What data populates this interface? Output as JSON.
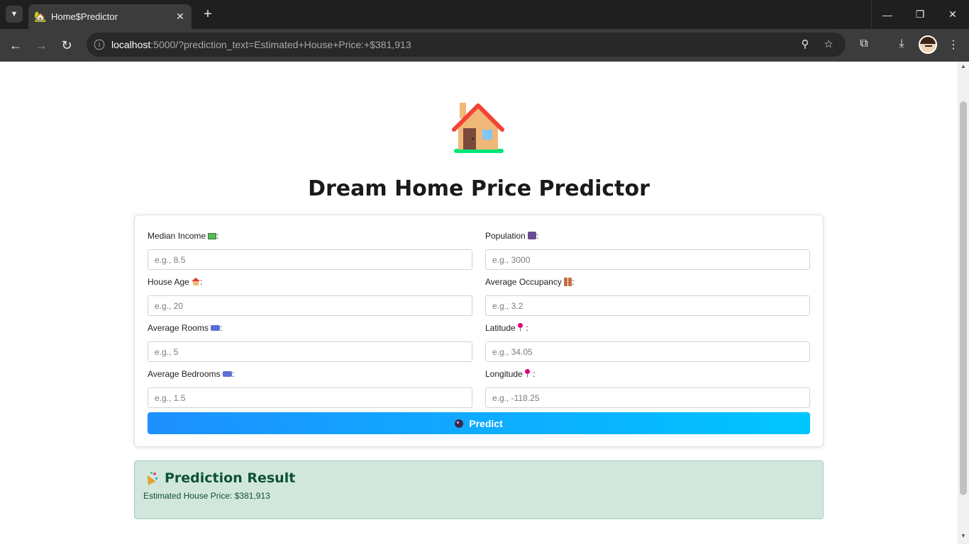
{
  "browser": {
    "tab_title": "Home$Predictor",
    "tab_close": "✕",
    "new_tab": "+",
    "url_host": "localhost",
    "url_rest": ":5000/?prediction_text=Estimated+House+Price:+$381,913",
    "icons": [
      "tab-search-icon",
      "favicon-house-icon",
      "close-icon",
      "plus-icon",
      "minimize-icon",
      "restore-icon",
      "close-window-icon",
      "back-arrow-icon",
      "forward-arrow-icon",
      "reload-icon",
      "site-info-icon",
      "zoom-icon",
      "star-icon",
      "extensions-icon",
      "download-icon",
      "avatar",
      "menu-dots-icon"
    ]
  },
  "page": {
    "title": "Dream Home Price Predictor",
    "form": {
      "fields": [
        {
          "label": "Median Income",
          "emoji": "money-icon",
          "placeholder": "e.g., 8.5",
          "value": ""
        },
        {
          "label": "Population",
          "emoji": "people-icon",
          "placeholder": "e.g., 3000",
          "value": ""
        },
        {
          "label": "House Age",
          "emoji": "house-icon",
          "placeholder": "e.g., 20",
          "value": ""
        },
        {
          "label": "Average Occupancy",
          "emoji": "couple-icon",
          "placeholder": "e.g., 3.2",
          "value": ""
        },
        {
          "label": "Average Rooms",
          "emoji": "bed-icon",
          "placeholder": "e.g., 5",
          "value": ""
        },
        {
          "label": "Latitude",
          "emoji": "pin-icon",
          "placeholder": "e.g., 34.05",
          "value": ""
        },
        {
          "label": "Average Bedrooms",
          "emoji": "bed-icon",
          "placeholder": "e.g., 1.5",
          "value": ""
        },
        {
          "label": "Longitude",
          "emoji": "pin-icon",
          "placeholder": "e.g., -118.25",
          "value": ""
        }
      ],
      "label_suffix": ":",
      "predict_label": "Predict"
    },
    "result": {
      "heading": "Prediction Result",
      "text": "Estimated House Price: $381,913"
    }
  },
  "colors": {
    "predict_gradient_start": "#1e90ff",
    "predict_gradient_end": "#00c6ff",
    "result_bg": "#d1e7dd",
    "result_text": "#0f5132"
  }
}
